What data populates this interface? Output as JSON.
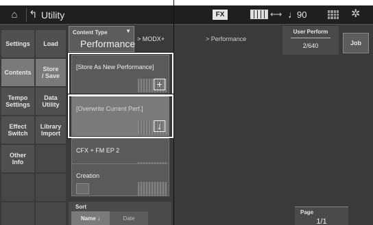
{
  "topbar": {
    "home_icon": "⌂",
    "back_icon": "↰",
    "title": "Utility",
    "fx_badge": "FX",
    "usb_icon": "⟷",
    "note_icon": "♩",
    "tempo": "90",
    "gear_icon": "✲"
  },
  "tabs_left": [
    {
      "label": "Settings",
      "selected": false
    },
    {
      "label": "Contents",
      "selected": true
    },
    {
      "label": "Tempo\nSettings",
      "selected": false
    },
    {
      "label": "Effect\nSwitch",
      "selected": false
    },
    {
      "label": "Other\nInfo",
      "selected": false
    }
  ],
  "tabs_sub": [
    {
      "label": "Load",
      "selected": false
    },
    {
      "label": "Store\n/ Save",
      "selected": true
    },
    {
      "label": "Data\nUtility",
      "selected": false
    },
    {
      "label": "Library\nImport",
      "selected": false
    }
  ],
  "content_type": {
    "label": "Content Type",
    "value": "Performance",
    "caret": "▼"
  },
  "bank": "> MODX+",
  "perf_path": "> Performance",
  "user_perform": {
    "label": "User Perform",
    "value": "2/640"
  },
  "job_button": "Job",
  "slots": [
    {
      "label": "[Store As New Performance]",
      "icon": "+"
    },
    {
      "label": "[Overwrite Current Perf.]",
      "icon": "↓"
    },
    {
      "label": "CFX + FM EP 2",
      "icon": ""
    },
    {
      "label": "Creation",
      "icon": ""
    }
  ],
  "sort": {
    "label": "Sort",
    "name_option": "Name ↓",
    "date_option": "Date"
  },
  "page": {
    "label": "Page",
    "value": "1/1"
  },
  "colors": {
    "background": "#3a3a3a",
    "topbar": "#1f1f1f",
    "selected_tab": "#7a7a7a",
    "tab": "#505050"
  }
}
